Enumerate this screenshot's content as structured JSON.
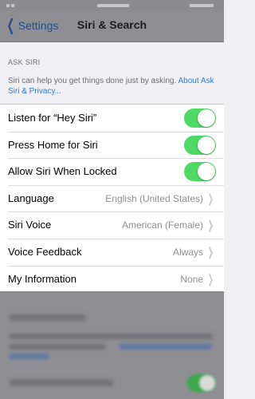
{
  "nav": {
    "back_label": "Settings",
    "title": "Siri & Search"
  },
  "section": {
    "header": "ASK SIRI",
    "footer_text": "Siri can help you get things done just by asking. ",
    "footer_link": "About Ask Siri & Privacy..."
  },
  "rows": [
    {
      "label": "Listen for “Hey Siri”",
      "toggle_on": true
    },
    {
      "label": "Press Home for Siri",
      "toggle_on": true
    },
    {
      "label": "Allow Siri When Locked",
      "toggle_on": true
    },
    {
      "label": "Language",
      "value": "English (United States)"
    },
    {
      "label": "Siri Voice",
      "value": "American (Female)"
    },
    {
      "label": "Voice Feedback",
      "value": "Always"
    },
    {
      "label": "My Information",
      "value": "None"
    }
  ],
  "colors": {
    "toggle_on": "#4cd964",
    "link": "#2f7bd6",
    "back": "#23508c"
  },
  "icons": {
    "back": "chevron-left-icon",
    "disclosure": "chevron-right-icon"
  }
}
